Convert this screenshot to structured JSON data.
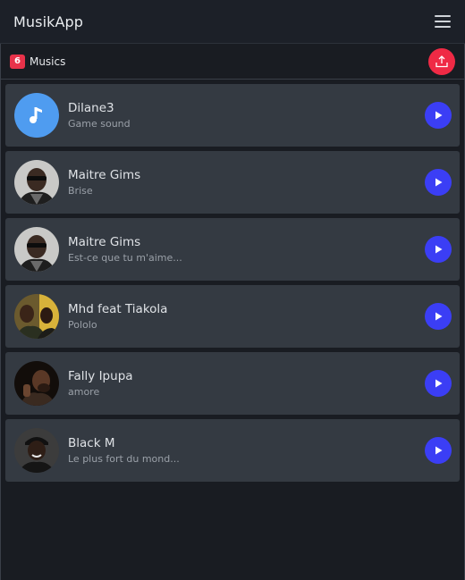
{
  "app": {
    "brand": "MusikApp",
    "menu_icon": "hamburger-icon"
  },
  "toolbar": {
    "count": "6",
    "count_label": "Musics",
    "upload_icon": "upload-icon",
    "upload_color": "#ef2a45"
  },
  "tracks": [
    {
      "artist": "Dilane3",
      "title": "Game sound",
      "avatar": "music-note-icon"
    },
    {
      "artist": "Maitre Gims",
      "title": "Brise",
      "avatar": "artist-photo"
    },
    {
      "artist": "Maitre Gims",
      "title": "Est-ce que tu m'aime...",
      "avatar": "artist-photo"
    },
    {
      "artist": "Mhd feat Tiakola",
      "title": "Pololo",
      "avatar": "artist-photo"
    },
    {
      "artist": "Fally Ipupa",
      "title": "amore",
      "avatar": "artist-photo"
    },
    {
      "artist": "Black M",
      "title": "Le plus fort du mond...",
      "avatar": "artist-photo"
    }
  ],
  "colors": {
    "play_button": "#3b3ef5",
    "badge": "#e8324a",
    "music_avatar": "#4f9cf0"
  }
}
